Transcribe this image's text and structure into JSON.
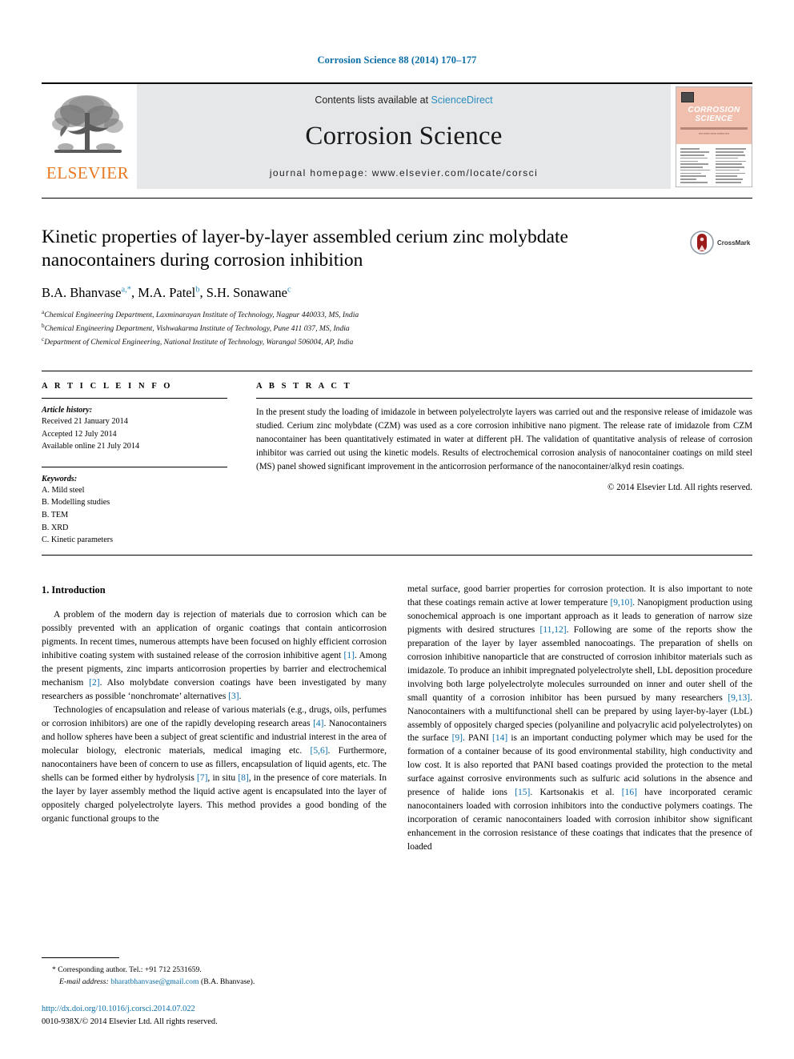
{
  "running_head": "Corrosion Science 88 (2014) 170–177",
  "masthead": {
    "publisher_logo_text": "ELSEVIER",
    "contents_prefix": "Contents lists available at ",
    "contents_link": "ScienceDirect",
    "journal_title": "Corrosion Science",
    "homepage_label": "journal homepage: www.elsevier.com/locate/corsci",
    "cover": {
      "line1": "CORROSION",
      "line2": "SCIENCE"
    }
  },
  "article": {
    "title": "Kinetic properties of layer-by-layer assembled cerium zinc molybdate nanocontainers during corrosion inhibition",
    "crossmark_label": "CrossMark",
    "authors": [
      {
        "name": "B.A. Bhanvase",
        "marks": "a,*"
      },
      {
        "name": "M.A. Patel",
        "marks": "b"
      },
      {
        "name": "S.H. Sonawane",
        "marks": "c"
      }
    ],
    "affiliations": [
      {
        "mark": "a",
        "text": "Chemical Engineering Department, Laxminarayan Institute of Technology, Nagpur 440033, MS, India"
      },
      {
        "mark": "b",
        "text": "Chemical Engineering Department, Vishwakarma Institute of Technology, Pune 411 037, MS, India"
      },
      {
        "mark": "c",
        "text": "Department of Chemical Engineering, National Institute of Technology, Warangal 506004, AP, India"
      }
    ]
  },
  "article_info": {
    "heading": "A R T I C L E   I N F O",
    "history_label": "Article history:",
    "history": [
      "Received 21 January 2014",
      "Accepted 12 July 2014",
      "Available online 21 July 2014"
    ],
    "keywords_label": "Keywords:",
    "keywords": [
      "A. Mild steel",
      "B. Modelling studies",
      "B. TEM",
      "B. XRD",
      "C. Kinetic parameters"
    ]
  },
  "abstract": {
    "heading": "A B S T R A C T",
    "text": "In the present study the loading of imidazole in between polyelectrolyte layers was carried out and the responsive release of imidazole was studied. Cerium zinc molybdate (CZM) was used as a core corrosion inhibitive nano pigment. The release rate of imidazole from CZM nanocontainer has been quantitatively estimated in water at different pH. The validation of quantitative analysis of release of corrosion inhibitor was carried out using the kinetic models. Results of electrochemical corrosion analysis of nanocontainer coatings on mild steel (MS) panel showed significant improvement in the anticorrosion performance of the nanocontainer/alkyd resin coatings.",
    "copyright": "© 2014 Elsevier Ltd. All rights reserved."
  },
  "body": {
    "section_heading": "1. Introduction",
    "left_paragraphs": [
      "A problem of the modern day is rejection of materials due to corrosion which can be possibly prevented with an application of organic coatings that contain anticorrosion pigments. In recent times, numerous attempts have been focused on highly efficient corrosion inhibitive coating system with sustained release of the corrosion inhibitive agent [1]. Among the present pigments, zinc imparts anticorrosion properties by barrier and electrochemical mechanism [2]. Also molybdate conversion coatings have been investigated by many researchers as possible ‘nonchromate’ alternatives [3].",
      "Technologies of encapsulation and release of various materials (e.g., drugs, oils, perfumes or corrosion inhibitors) are one of the rapidly developing research areas [4]. Nanocontainers and hollow spheres have been a subject of great scientific and industrial interest in the area of molecular biology, electronic materials, medical imaging etc. [5,6]. Furthermore, nanocontainers have been of concern to use as fillers, encapsulation of liquid agents, etc. The shells can be formed either by hydrolysis [7], in situ [8], in the presence of core materials. In the layer by layer assembly method the liquid active agent is encapsulated into the layer of oppositely charged polyelectrolyte layers. This method provides a good bonding of the organic functional groups to the"
    ],
    "right_paragraphs": [
      "metal surface, good barrier properties for corrosion protection. It is also important to note that these coatings remain active at lower temperature [9,10]. Nanopigment production using sonochemical approach is one important approach as it leads to generation of narrow size pigments with desired structures [11,12]. Following are some of the reports show the preparation of the layer by layer assembled nanocoatings. The preparation of shells on corrosion inhibitive nanoparticle that are constructed of corrosion inhibitor materials such as imidazole. To produce an inhibit impregnated polyelectrolyte shell, LbL deposition procedure involving both large polyelectrolyte molecules surrounded on inner and outer shell of the small quantity of a corrosion inhibitor has been pursued by many researchers [9,13]. Nanocontainers with a multifunctional shell can be prepared by using layer-by-layer (LbL) assembly of oppositely charged species (polyaniline and polyacrylic acid polyelectrolytes) on the surface [9]. PANI [14] is an important conducting polymer which may be used for the formation of a container because of its good environmental stability, high conductivity and low cost. It is also reported that PANI based coatings provided the protection to the metal surface against corrosive environments such as sulfuric acid solutions in the absence and presence of halide ions [15]. Kartsonakis et al. [16] have incorporated ceramic nanocontainers loaded with corrosion inhibitors into the conductive polymers coatings. The incorporation of ceramic nanocontainers loaded with corrosion inhibitor show significant enhancement in the corrosion resistance of these coatings that indicates that the presence of loaded"
    ]
  },
  "footnote": {
    "corresponding": "* Corresponding author. Tel.: +91 712 2531659.",
    "email_label": "E-mail address:",
    "email": "bharatbhanvase@gmail.com",
    "email_suffix": "(B.A. Bhanvase)."
  },
  "footer": {
    "doi": "http://dx.doi.org/10.1016/j.corsci.2014.07.022",
    "issn_line": "0010-938X/© 2014 Elsevier Ltd. All rights reserved."
  },
  "colors": {
    "link": "#0b6ea8",
    "sciencedirect": "#2b8cbe",
    "elsevier_orange": "#E87722",
    "masthead_gray": "#e6e7e8",
    "cover_salmon": "#f0bfae"
  }
}
